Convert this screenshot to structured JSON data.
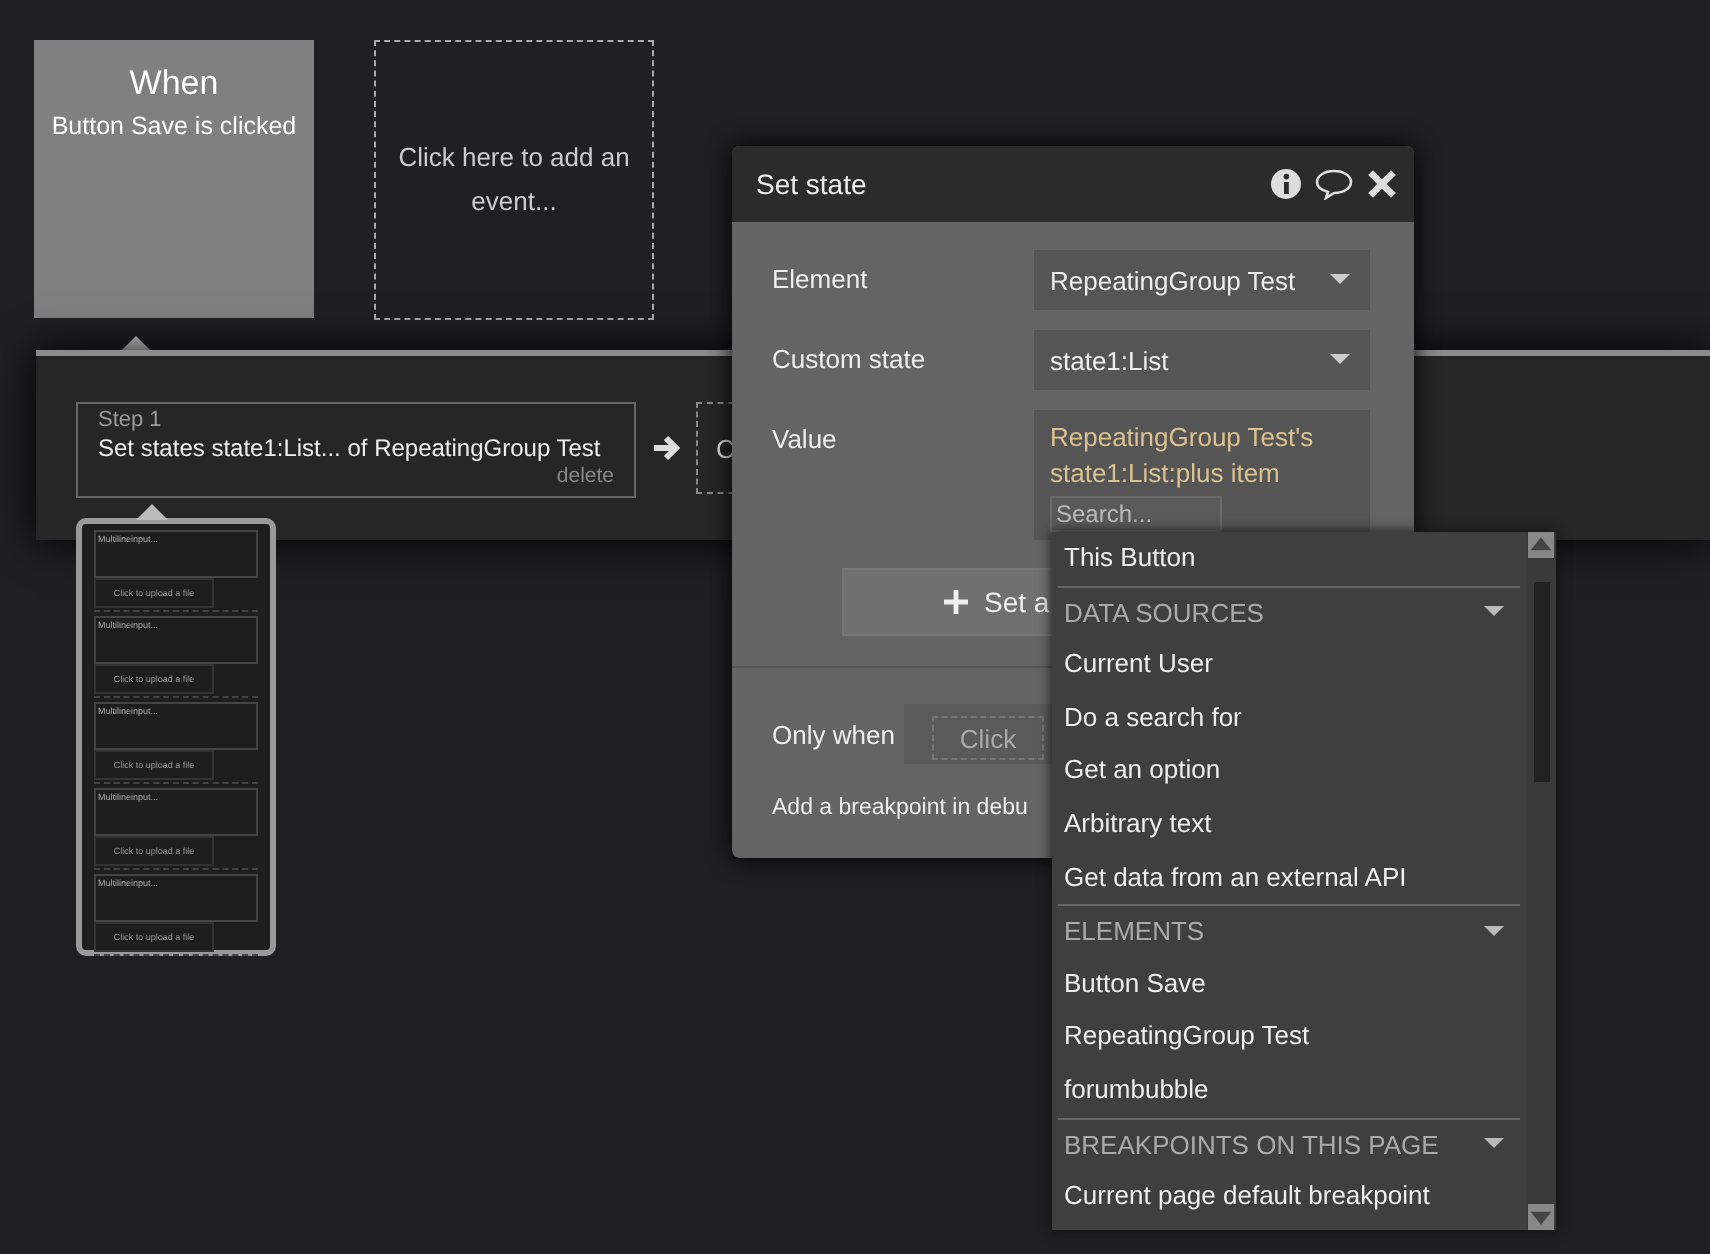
{
  "event": {
    "title": "When",
    "subtitle": "Button Save is clicked"
  },
  "add_event": {
    "label": "Click here to add an event..."
  },
  "steps": [
    {
      "step_label": "Step 1",
      "action": "Set states state1:List... of RepeatingGroup Test",
      "delete": "delete"
    }
  ],
  "next_step": {
    "label": "C"
  },
  "preview": {
    "items": [
      {
        "input": "Multilineinput...",
        "upload": "Click to upload a file"
      },
      {
        "input": "Multilineinput...",
        "upload": "Click to upload a file"
      },
      {
        "input": "Multilineinput...",
        "upload": "Click to upload a file"
      },
      {
        "input": "Multilineinput...",
        "upload": "Click to upload a file"
      },
      {
        "input": "Multilineinput...",
        "upload": "Click to upload a file"
      }
    ]
  },
  "dialog": {
    "title": "Set state",
    "fields": [
      {
        "kind": "dropdown",
        "label": "Element",
        "value": "RepeatingGroup Test"
      },
      {
        "kind": "dropdown",
        "label": "Custom state",
        "value": "state1:List"
      },
      {
        "kind": "expression",
        "label": "Value",
        "value": "RepeatingGroup Test's state1:List:plus item",
        "placeholder": "Search..."
      }
    ],
    "add_button": "Set a",
    "only_when": {
      "label": "Only when",
      "placeholder": "Click"
    },
    "breakpoint": "Add a breakpoint in debu"
  },
  "dropdown": {
    "items": [
      {
        "kind": "item",
        "label": "This Button"
      },
      {
        "kind": "section",
        "label": "DATA SOURCES"
      },
      {
        "kind": "item",
        "label": "Current User"
      },
      {
        "kind": "item",
        "label": "Do a search for"
      },
      {
        "kind": "item",
        "label": "Get an option"
      },
      {
        "kind": "item",
        "label": "Arbitrary text"
      },
      {
        "kind": "item",
        "label": "Get data from an external API"
      },
      {
        "kind": "section",
        "label": "ELEMENTS"
      },
      {
        "kind": "item",
        "label": "Button Save"
      },
      {
        "kind": "item",
        "label": "RepeatingGroup Test"
      },
      {
        "kind": "item",
        "label": "forumbubble"
      },
      {
        "kind": "section",
        "label": "BREAKPOINTS ON THIS PAGE"
      },
      {
        "kind": "item",
        "label": "Current page default breakpoint"
      }
    ]
  }
}
